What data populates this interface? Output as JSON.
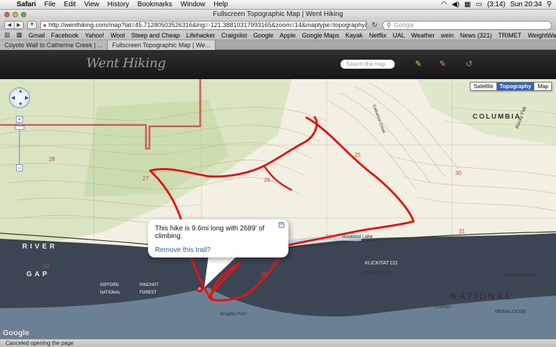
{
  "menubar": {
    "app": "Safari",
    "items": [
      "File",
      "Edit",
      "View",
      "History",
      "Bookmarks",
      "Window",
      "Help"
    ],
    "battery": "(3:14)",
    "clock": "Sun 20:34"
  },
  "window": {
    "title": "Fullscreen Topographic Map | Went Hiking"
  },
  "toolbar": {
    "url": "http://wenthiking.com/map?lat=45.71280503526316&lng=-121.38810317993165&zoom=14&maptype=topography&hik",
    "search_placeholder": "Google"
  },
  "bookmarks": [
    "Gmail",
    "Facebook",
    "Yahoo!",
    "Woot",
    "Steep and Cheap",
    "Lifehacker",
    "Craigslist",
    "Google",
    "Apple",
    "Google Maps",
    "Kayak",
    "Netflix",
    "UAL",
    "Weather",
    "wein",
    "News (321)",
    "TRIMET",
    "WeightWatchers"
  ],
  "tabs": [
    {
      "label": "Coyote Wall to Catherine Creek | ..."
    },
    {
      "label": "Fullscreen Topographic Map | We..."
    }
  ],
  "site": {
    "logo": "Went Hiking",
    "search_placeholder": "Search the map"
  },
  "map": {
    "types": [
      "Satellite",
      "Topography",
      "Map"
    ],
    "selected_type": "Topography",
    "labels": {
      "columbia": "COLUMBIA",
      "national": "NATIONAL",
      "river": "RIVER",
      "gap": "GAP",
      "gifford": "GIFFORD",
      "pinchot": "PINCHOT",
      "forest": "FOREST",
      "klickitat": "KLICKITAT CO",
      "wasco": "WASCO CO",
      "rowland": "Rowland Lake",
      "memaloose": "MEMALOOSE",
      "memaloose_lake": "Memaloose Lake",
      "chatfield": "Chatfield",
      "straights_point": "Straights Point",
      "catherine_creek": "Catherine Creek",
      "rocky_flat": "Rocky Flat",
      "google": "Google"
    },
    "info_window": {
      "message": "This hike is 9.6mi long with 2689' of climbing.",
      "link": "Remove this trail?"
    }
  },
  "status": "Canceled opening the page",
  "colors": {
    "trail": "#e31414",
    "water": "#3c4554",
    "accent": "#2f64b8"
  }
}
